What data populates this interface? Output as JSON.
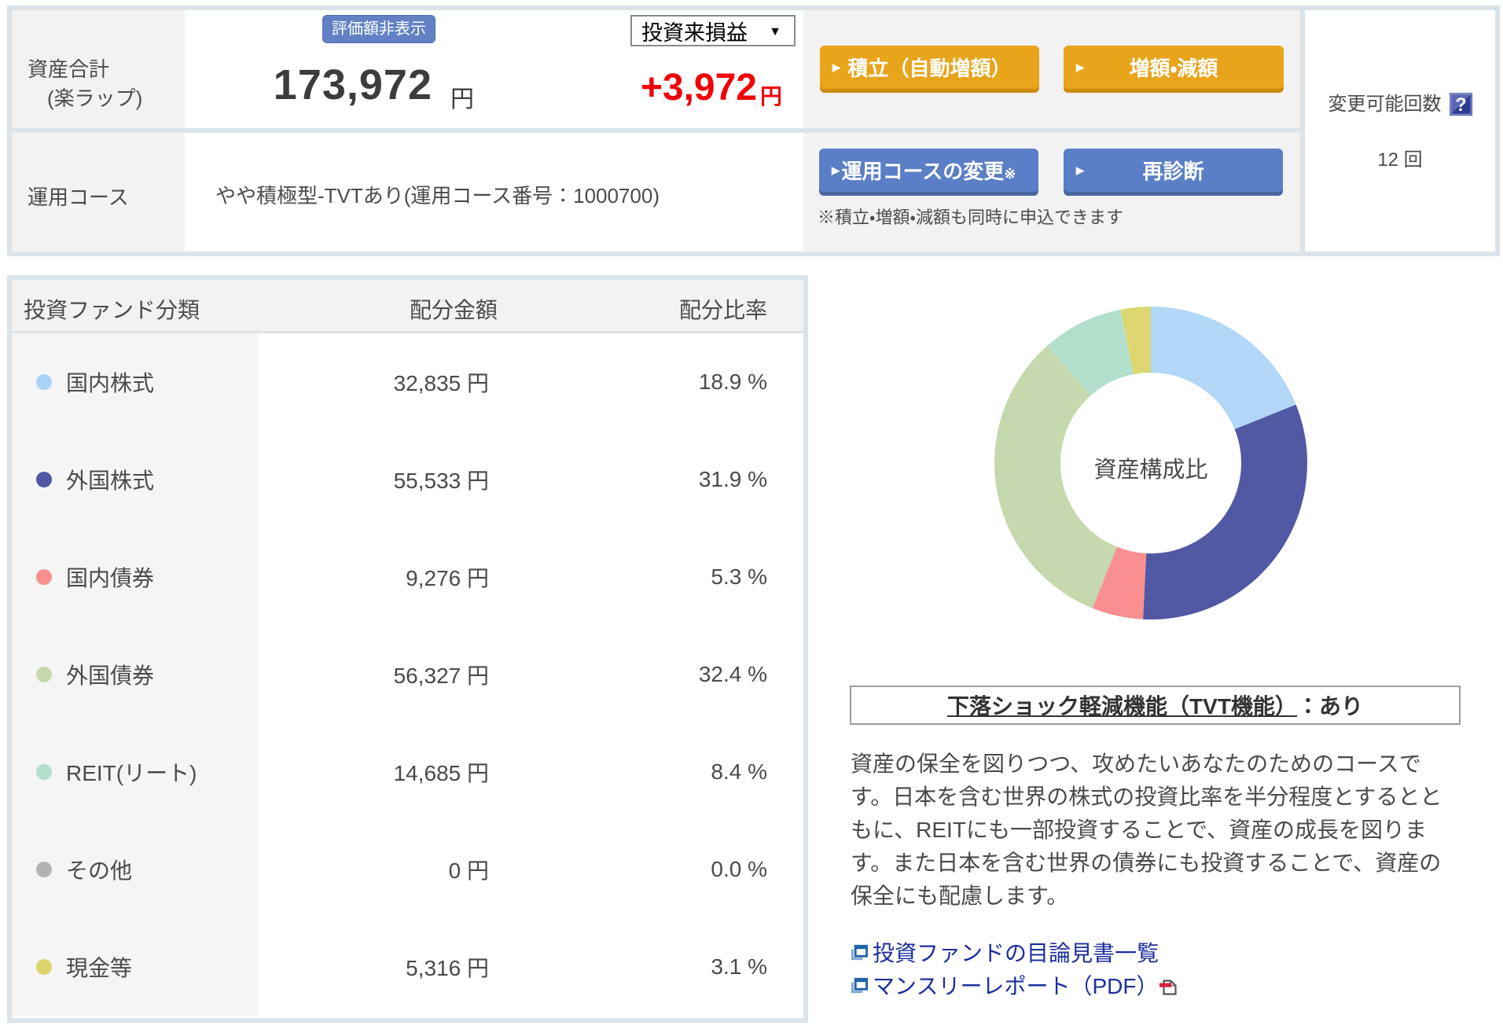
{
  "summary": {
    "row_total": {
      "label": "資産合計\n(楽ラップ)",
      "hide_value_button": "評価額非表示",
      "period_select_value": "投資来損益",
      "total_value": "173,972",
      "total_unit": "円",
      "profit_loss_value": "+3,972",
      "profit_loss_unit": "円",
      "accent_red": "#f00008"
    },
    "row_course": {
      "label": "運用コース",
      "course_name": "やや積極型-TVTあり(運用コース番号：1000700)",
      "note": "※積立・増額・減額も同時に申込できます"
    },
    "buttons": {
      "tsumitate": "積立（自動増額）",
      "zougaku": "増額・減額",
      "course_change": "運用コースの変更",
      "course_change_sup": "※",
      "rediagnose": "再診断",
      "orange": "#e8a41b",
      "blue": "#5b7fc6"
    },
    "side": {
      "title": "変更可能回数",
      "help_icon": "question-mark",
      "count": "12 回"
    }
  },
  "table": {
    "headers": {
      "classification": "投資ファンド分類",
      "amount": "配分金額",
      "ratio": "配分比率"
    },
    "rows": [
      {
        "label": "国内株式",
        "amount": "32,835 円",
        "ratio": "18.9 %",
        "color": "#a9d4f5"
      },
      {
        "label": "外国株式",
        "amount": "55,533 円",
        "ratio": "31.9 %",
        "color": "#5057a3"
      },
      {
        "label": "国内債券",
        "amount": "9,276 円",
        "ratio": "5.3 %",
        "color": "#f9908f"
      },
      {
        "label": "外国債券",
        "amount": "56,327 円",
        "ratio": "32.4 %",
        "color": "#c6d9ae"
      },
      {
        "label": "REIT(リート)",
        "amount": "14,685 円",
        "ratio": "8.4 %",
        "color": "#b2dfcc"
      },
      {
        "label": "その他",
        "amount": "0 円",
        "ratio": "0.0 %",
        "color": "#b3b3b3"
      },
      {
        "label": "現金等",
        "amount": "5,316 円",
        "ratio": "3.1 %",
        "color": "#dcd56d"
      }
    ]
  },
  "chart_data": {
    "type": "pie",
    "title": "資産構成比",
    "categories": [
      "国内株式",
      "外国株式",
      "国内債券",
      "外国債券",
      "REIT(リート)",
      "その他",
      "現金等"
    ],
    "values": [
      18.9,
      31.9,
      5.3,
      32.4,
      8.4,
      0.0,
      3.1
    ],
    "colors": [
      "#b3d8f7",
      "#5159a5",
      "#f9908f",
      "#c6d9ae",
      "#b2dfcc",
      "#b3b3b3",
      "#ddd670"
    ],
    "center_label": "資産構成比",
    "donut": true,
    "start_angle_deg": 0,
    "clockwise": true
  },
  "tvt": {
    "title_link": "下落ショック軽減機能（TVT機能）",
    "title_value": "：あり",
    "description": "資産の保全を図りつつ、攻めたいあなたのためのコースで\nす。日本を含む世界の株式の投資比率を半分程度とするとと\nもに、REITにも一部投資することで、資産の成長を図りま\nす。また日本を含む世界の債券にも投資することで、資産の\n保全にも配慮します。",
    "links": [
      {
        "label": "投資ファンドの目論見書一覧",
        "pdf": false
      },
      {
        "label": "マンスリーレポート（PDF）",
        "pdf": true
      }
    ]
  }
}
